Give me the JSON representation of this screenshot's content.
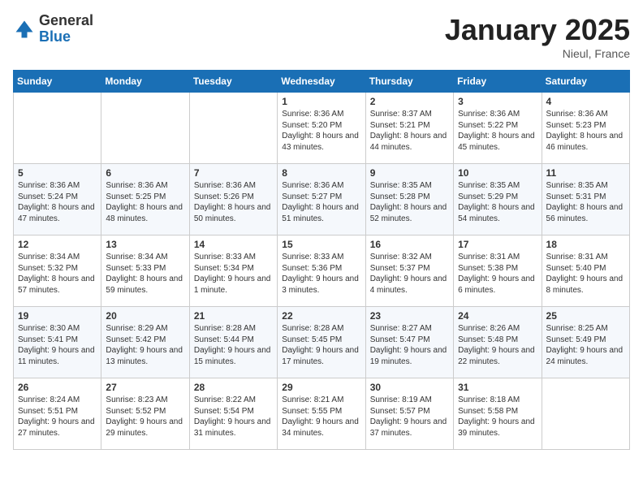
{
  "header": {
    "logo_general": "General",
    "logo_blue": "Blue",
    "month_title": "January 2025",
    "location": "Nieul, France"
  },
  "weekdays": [
    "Sunday",
    "Monday",
    "Tuesday",
    "Wednesday",
    "Thursday",
    "Friday",
    "Saturday"
  ],
  "weeks": [
    [
      {
        "day": "",
        "empty": true
      },
      {
        "day": "",
        "empty": true
      },
      {
        "day": "",
        "empty": true
      },
      {
        "day": "1",
        "sunrise": "Sunrise: 8:36 AM",
        "sunset": "Sunset: 5:20 PM",
        "daylight": "Daylight: 8 hours and 43 minutes."
      },
      {
        "day": "2",
        "sunrise": "Sunrise: 8:37 AM",
        "sunset": "Sunset: 5:21 PM",
        "daylight": "Daylight: 8 hours and 44 minutes."
      },
      {
        "day": "3",
        "sunrise": "Sunrise: 8:36 AM",
        "sunset": "Sunset: 5:22 PM",
        "daylight": "Daylight: 8 hours and 45 minutes."
      },
      {
        "day": "4",
        "sunrise": "Sunrise: 8:36 AM",
        "sunset": "Sunset: 5:23 PM",
        "daylight": "Daylight: 8 hours and 46 minutes."
      }
    ],
    [
      {
        "day": "5",
        "sunrise": "Sunrise: 8:36 AM",
        "sunset": "Sunset: 5:24 PM",
        "daylight": "Daylight: 8 hours and 47 minutes."
      },
      {
        "day": "6",
        "sunrise": "Sunrise: 8:36 AM",
        "sunset": "Sunset: 5:25 PM",
        "daylight": "Daylight: 8 hours and 48 minutes."
      },
      {
        "day": "7",
        "sunrise": "Sunrise: 8:36 AM",
        "sunset": "Sunset: 5:26 PM",
        "daylight": "Daylight: 8 hours and 50 minutes."
      },
      {
        "day": "8",
        "sunrise": "Sunrise: 8:36 AM",
        "sunset": "Sunset: 5:27 PM",
        "daylight": "Daylight: 8 hours and 51 minutes."
      },
      {
        "day": "9",
        "sunrise": "Sunrise: 8:35 AM",
        "sunset": "Sunset: 5:28 PM",
        "daylight": "Daylight: 8 hours and 52 minutes."
      },
      {
        "day": "10",
        "sunrise": "Sunrise: 8:35 AM",
        "sunset": "Sunset: 5:29 PM",
        "daylight": "Daylight: 8 hours and 54 minutes."
      },
      {
        "day": "11",
        "sunrise": "Sunrise: 8:35 AM",
        "sunset": "Sunset: 5:31 PM",
        "daylight": "Daylight: 8 hours and 56 minutes."
      }
    ],
    [
      {
        "day": "12",
        "sunrise": "Sunrise: 8:34 AM",
        "sunset": "Sunset: 5:32 PM",
        "daylight": "Daylight: 8 hours and 57 minutes."
      },
      {
        "day": "13",
        "sunrise": "Sunrise: 8:34 AM",
        "sunset": "Sunset: 5:33 PM",
        "daylight": "Daylight: 8 hours and 59 minutes."
      },
      {
        "day": "14",
        "sunrise": "Sunrise: 8:33 AM",
        "sunset": "Sunset: 5:34 PM",
        "daylight": "Daylight: 9 hours and 1 minute."
      },
      {
        "day": "15",
        "sunrise": "Sunrise: 8:33 AM",
        "sunset": "Sunset: 5:36 PM",
        "daylight": "Daylight: 9 hours and 3 minutes."
      },
      {
        "day": "16",
        "sunrise": "Sunrise: 8:32 AM",
        "sunset": "Sunset: 5:37 PM",
        "daylight": "Daylight: 9 hours and 4 minutes."
      },
      {
        "day": "17",
        "sunrise": "Sunrise: 8:31 AM",
        "sunset": "Sunset: 5:38 PM",
        "daylight": "Daylight: 9 hours and 6 minutes."
      },
      {
        "day": "18",
        "sunrise": "Sunrise: 8:31 AM",
        "sunset": "Sunset: 5:40 PM",
        "daylight": "Daylight: 9 hours and 8 minutes."
      }
    ],
    [
      {
        "day": "19",
        "sunrise": "Sunrise: 8:30 AM",
        "sunset": "Sunset: 5:41 PM",
        "daylight": "Daylight: 9 hours and 11 minutes."
      },
      {
        "day": "20",
        "sunrise": "Sunrise: 8:29 AM",
        "sunset": "Sunset: 5:42 PM",
        "daylight": "Daylight: 9 hours and 13 minutes."
      },
      {
        "day": "21",
        "sunrise": "Sunrise: 8:28 AM",
        "sunset": "Sunset: 5:44 PM",
        "daylight": "Daylight: 9 hours and 15 minutes."
      },
      {
        "day": "22",
        "sunrise": "Sunrise: 8:28 AM",
        "sunset": "Sunset: 5:45 PM",
        "daylight": "Daylight: 9 hours and 17 minutes."
      },
      {
        "day": "23",
        "sunrise": "Sunrise: 8:27 AM",
        "sunset": "Sunset: 5:47 PM",
        "daylight": "Daylight: 9 hours and 19 minutes."
      },
      {
        "day": "24",
        "sunrise": "Sunrise: 8:26 AM",
        "sunset": "Sunset: 5:48 PM",
        "daylight": "Daylight: 9 hours and 22 minutes."
      },
      {
        "day": "25",
        "sunrise": "Sunrise: 8:25 AM",
        "sunset": "Sunset: 5:49 PM",
        "daylight": "Daylight: 9 hours and 24 minutes."
      }
    ],
    [
      {
        "day": "26",
        "sunrise": "Sunrise: 8:24 AM",
        "sunset": "Sunset: 5:51 PM",
        "daylight": "Daylight: 9 hours and 27 minutes."
      },
      {
        "day": "27",
        "sunrise": "Sunrise: 8:23 AM",
        "sunset": "Sunset: 5:52 PM",
        "daylight": "Daylight: 9 hours and 29 minutes."
      },
      {
        "day": "28",
        "sunrise": "Sunrise: 8:22 AM",
        "sunset": "Sunset: 5:54 PM",
        "daylight": "Daylight: 9 hours and 31 minutes."
      },
      {
        "day": "29",
        "sunrise": "Sunrise: 8:21 AM",
        "sunset": "Sunset: 5:55 PM",
        "daylight": "Daylight: 9 hours and 34 minutes."
      },
      {
        "day": "30",
        "sunrise": "Sunrise: 8:19 AM",
        "sunset": "Sunset: 5:57 PM",
        "daylight": "Daylight: 9 hours and 37 minutes."
      },
      {
        "day": "31",
        "sunrise": "Sunrise: 8:18 AM",
        "sunset": "Sunset: 5:58 PM",
        "daylight": "Daylight: 9 hours and 39 minutes."
      },
      {
        "day": "",
        "empty": true
      }
    ]
  ]
}
